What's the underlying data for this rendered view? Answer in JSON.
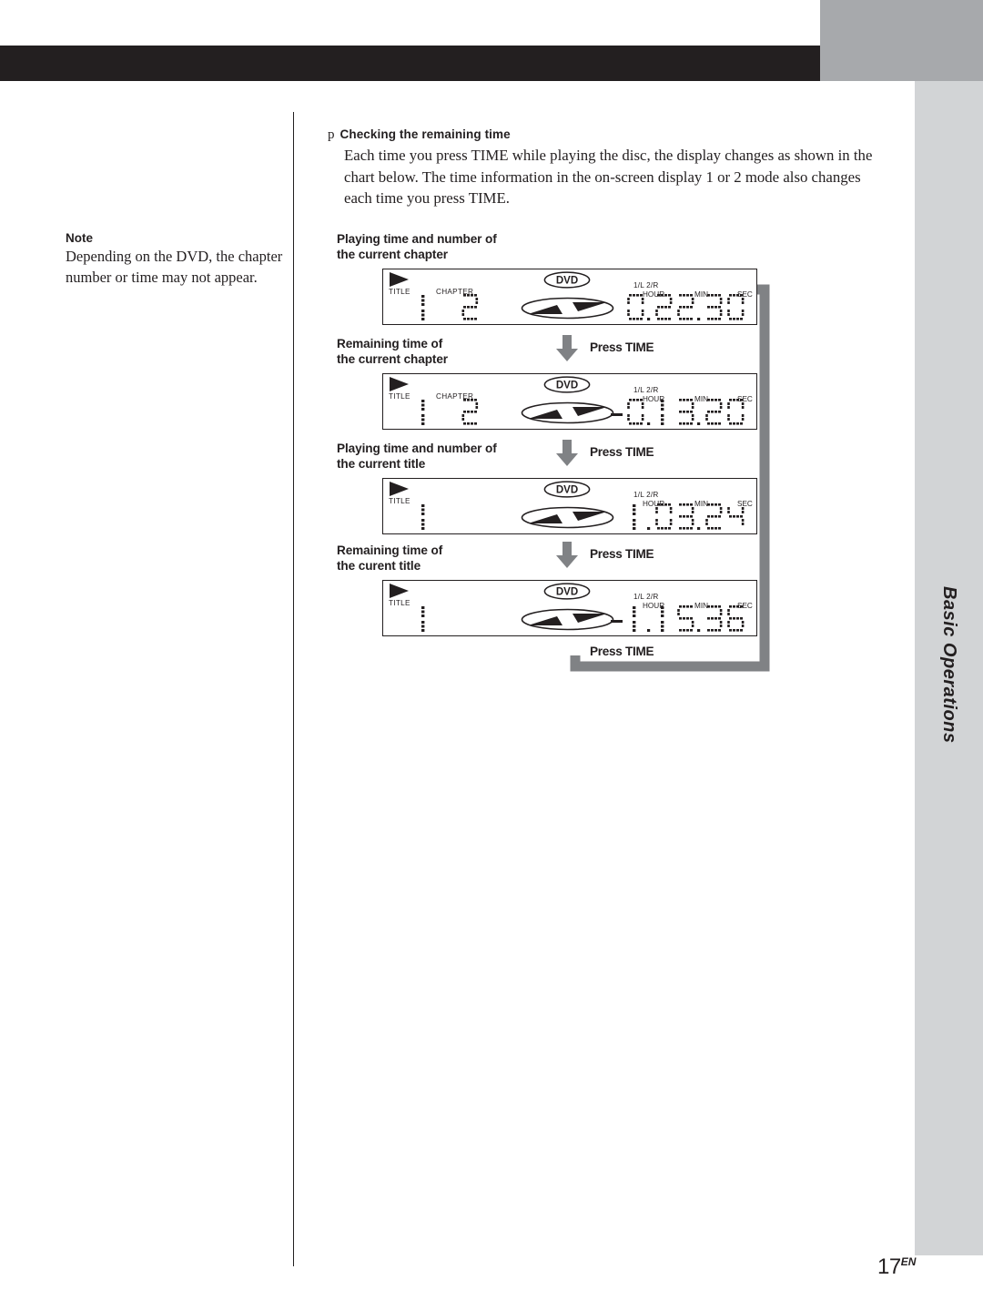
{
  "page": {
    "number": "17",
    "number_suffix": "EN",
    "side_tab": "Basic Operations"
  },
  "note": {
    "title": "Note",
    "body": "Depending on the DVD, the chapter number or time may not appear."
  },
  "intro": {
    "bullet": "p",
    "title": "Checking the remaining time",
    "body": "Each time you press TIME while playing the disc, the display changes as shown in the chart below.  The time information in the on-screen display 1 or 2 mode also changes each time you press TIME."
  },
  "diagram": {
    "press_time_label": "Press TIME",
    "loop_press_time_label": "Press TIME",
    "panel_labels": {
      "title": "TITLE",
      "chapter": "CHAPTER",
      "lr": "1/L  2/R",
      "hour": "HOUR",
      "min": "MIN",
      "sec": "SEC",
      "dvd": "DVD"
    },
    "steps": [
      {
        "caption": "Playing time and number of\nthe current chapter",
        "title_num": "1",
        "chapter_num": "2",
        "show_chapter": true,
        "minus": false,
        "time": "0.22.30",
        "hour": "0",
        "minute": "22",
        "second": "30"
      },
      {
        "caption": "Remaining time of\nthe current chapter",
        "title_num": "1",
        "chapter_num": "2",
        "show_chapter": true,
        "minus": true,
        "time": "-0.13.20",
        "hour": "0",
        "minute": "13",
        "second": "20"
      },
      {
        "caption": "Playing time and number of\nthe current title",
        "title_num": "1",
        "chapter_num": "",
        "show_chapter": false,
        "minus": false,
        "time": "1.03.24",
        "hour": "1",
        "minute": "03",
        "second": "24"
      },
      {
        "caption": "Remaining time of\nthe curent title",
        "title_num": "1",
        "chapter_num": "",
        "show_chapter": false,
        "minus": true,
        "time": "-1.15.36",
        "hour": "1",
        "minute": "15",
        "second": "36"
      }
    ]
  },
  "colors": {
    "ink": "#231f20",
    "top_gray": "#a7a9ac",
    "side_gray": "#d2d4d6",
    "arrow_gray": "#808285"
  }
}
